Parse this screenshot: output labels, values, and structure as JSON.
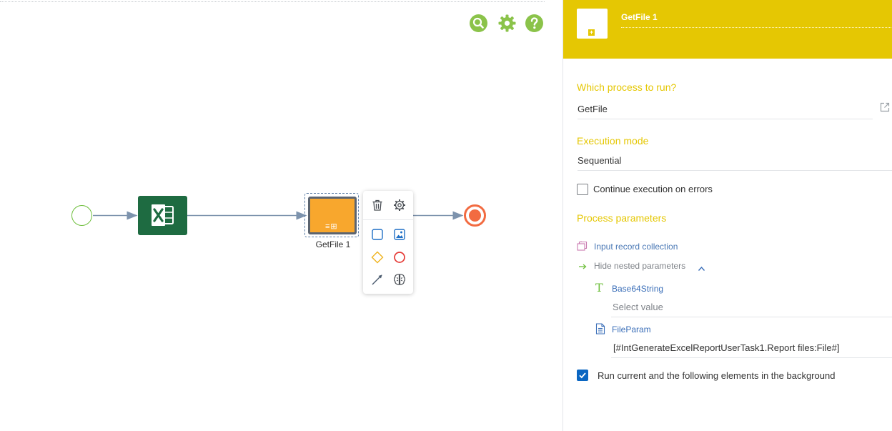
{
  "canvas": {
    "toolbar": {
      "search_icon": "search-icon",
      "settings_icon": "gear-icon",
      "help_icon": "help-icon",
      "accent": "#8bc34a"
    },
    "diagram": {
      "start_event_color": "#6fbf3d",
      "excel_task_color": "#1e6b41",
      "subprocess_color": "#f8a72d",
      "subprocess_label": "GetFile 1",
      "subprocess_markers": "≡⊞",
      "end_event_color": "#f26b41"
    },
    "context_menu": {
      "items": [
        "delete-icon",
        "settings-icon",
        "user-task-icon",
        "image-task-icon",
        "gateway-icon",
        "end-event-icon",
        "connector-arrow-icon",
        "ai-brain-icon"
      ]
    }
  },
  "panel": {
    "header": {
      "title": "GetFile 1",
      "color": "#e5c703"
    },
    "process": {
      "label": "Which process to run?",
      "value": "GetFile"
    },
    "execution": {
      "label": "Execution mode",
      "value": "Sequential"
    },
    "continue_on_errors": {
      "label": "Continue execution on errors",
      "checked": false
    },
    "parameters": {
      "title": "Process parameters",
      "collection_link": "Input record collection",
      "nested_toggle": "Hide nested parameters",
      "items": [
        {
          "name": "Base64String",
          "placeholder": "Select value",
          "value": ""
        },
        {
          "name": "FileParam",
          "placeholder": "",
          "value": "[#IntGenerateExcelReportUserTask1.Report files:File#]"
        }
      ]
    },
    "background": {
      "label": "Run current and the following elements in the background",
      "checked": true
    }
  }
}
